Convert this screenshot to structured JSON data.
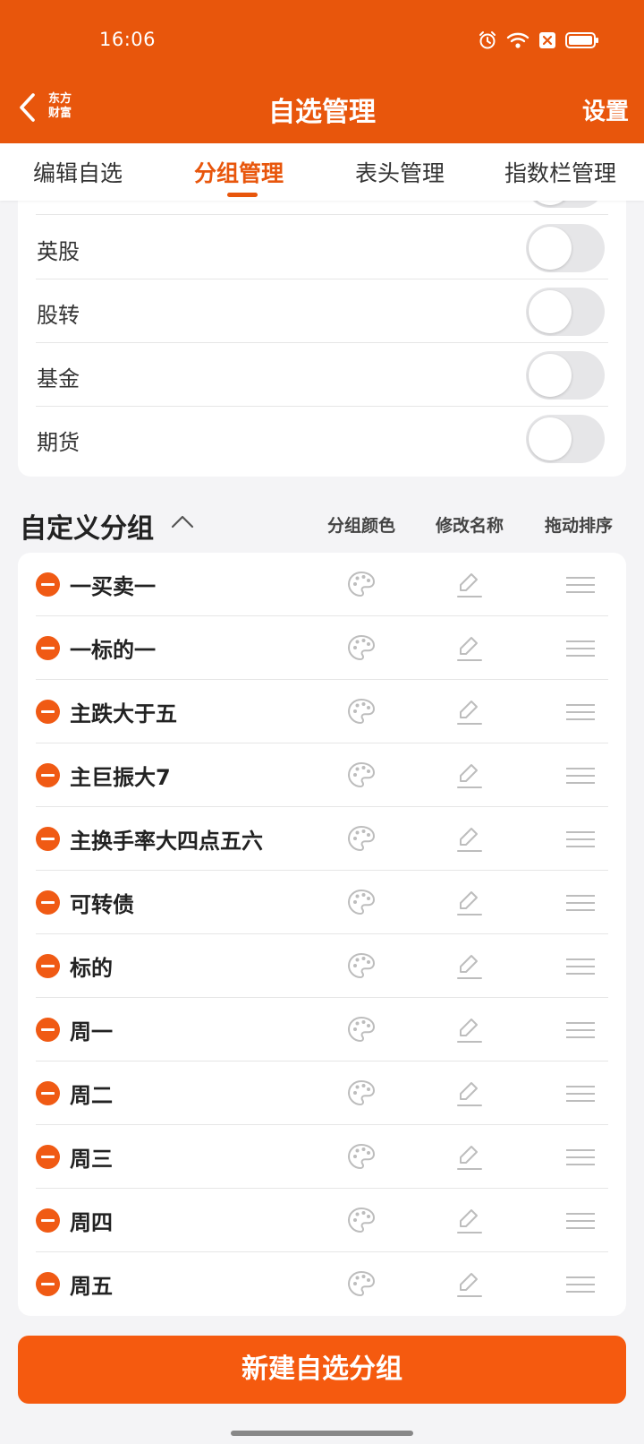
{
  "status_bar": {
    "time": "16:06"
  },
  "colors": {
    "accent": "#e8560c",
    "button": "#f55a0f",
    "minus": "#f05a14"
  },
  "header": {
    "logo_line1": "东方",
    "logo_line2": "财富",
    "title": "自选管理",
    "settings": "设置"
  },
  "tabs": [
    {
      "label": "编辑自选",
      "active": false
    },
    {
      "label": "分组管理",
      "active": true
    },
    {
      "label": "表头管理",
      "active": false
    },
    {
      "label": "指数栏管理",
      "active": false
    }
  ],
  "market_groups": [
    {
      "label": "英股",
      "enabled": false
    },
    {
      "label": "股转",
      "enabled": false
    },
    {
      "label": "基金",
      "enabled": false
    },
    {
      "label": "期货",
      "enabled": false
    }
  ],
  "custom_section": {
    "title": "自定义分组",
    "col_color": "分组颜色",
    "col_rename": "修改名称",
    "col_sort": "拖动排序"
  },
  "custom_groups": [
    {
      "name": "一买卖一"
    },
    {
      "name": "一标的一"
    },
    {
      "name": "主跌大于五"
    },
    {
      "name": "主巨振大7"
    },
    {
      "name": "主换手率大四点五六"
    },
    {
      "name": "可转债"
    },
    {
      "name": "标的"
    },
    {
      "name": "周一"
    },
    {
      "name": "周二"
    },
    {
      "name": "周三"
    },
    {
      "name": "周四"
    },
    {
      "name": "周五"
    }
  ],
  "icons": {
    "back": "chevron-left-icon",
    "collapse": "chevron-up-icon",
    "delete": "minus-circle-icon",
    "color": "palette-icon",
    "rename": "pencil-icon",
    "sort": "drag-handle-icon"
  },
  "footer": {
    "new_group_button": "新建自选分组"
  }
}
